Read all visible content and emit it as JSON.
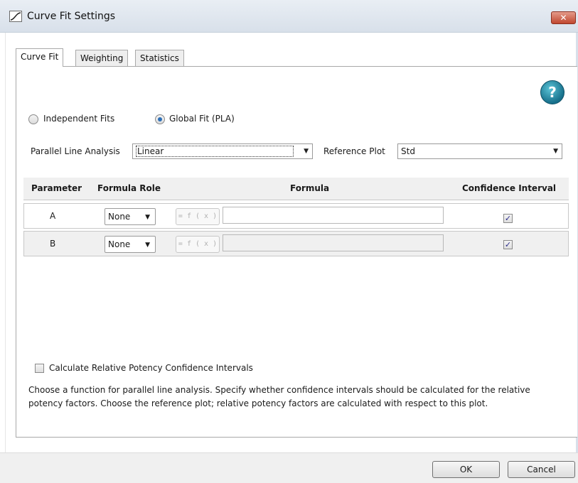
{
  "window": {
    "title": "Curve Fit Settings",
    "close_label": "✕"
  },
  "tabs": [
    "Curve Fit",
    "Weighting",
    "Statistics"
  ],
  "active_tab": "Curve Fit",
  "help_label": "?",
  "fit_mode": {
    "options": [
      "Independent Fits",
      "Global Fit (PLA)"
    ],
    "selected": "Global Fit (PLA)"
  },
  "pla": {
    "label": "Parallel  Line Analysis",
    "value": "Linear",
    "ref_label": "Reference Plot",
    "ref_value": "Std"
  },
  "table": {
    "headers": [
      "Parameter",
      "Formula Role",
      "Formula",
      "Confidence Interval"
    ],
    "rows": [
      {
        "parameter": "A",
        "role": "None",
        "fx": "= f ( x )",
        "formula": "",
        "ci_checked": true
      },
      {
        "parameter": "B",
        "role": "None",
        "fx": "= f ( x )",
        "formula": "",
        "ci_checked": true
      }
    ]
  },
  "rel_potency_checkbox": {
    "label": "Calculate Relative Potency Confidence Intervals",
    "checked": false
  },
  "description": "Choose a function for parallel line analysis. Specify whether confidence intervals should be calculated for the relative potency factors. Choose the reference plot; relative potency factors are calculated with respect to this plot.",
  "buttons": {
    "ok": "OK",
    "cancel": "Cancel"
  },
  "icons": {
    "app": "curve-fit-icon",
    "close": "close-icon",
    "help": "help-icon",
    "dropdown": "chevron-down-icon",
    "check": "checkmark-icon"
  },
  "colors": {
    "titlebar": "#dfe6ee",
    "close": "#c9553e",
    "help": "#1f8aa6",
    "radio_dot": "#2d6fb7"
  }
}
